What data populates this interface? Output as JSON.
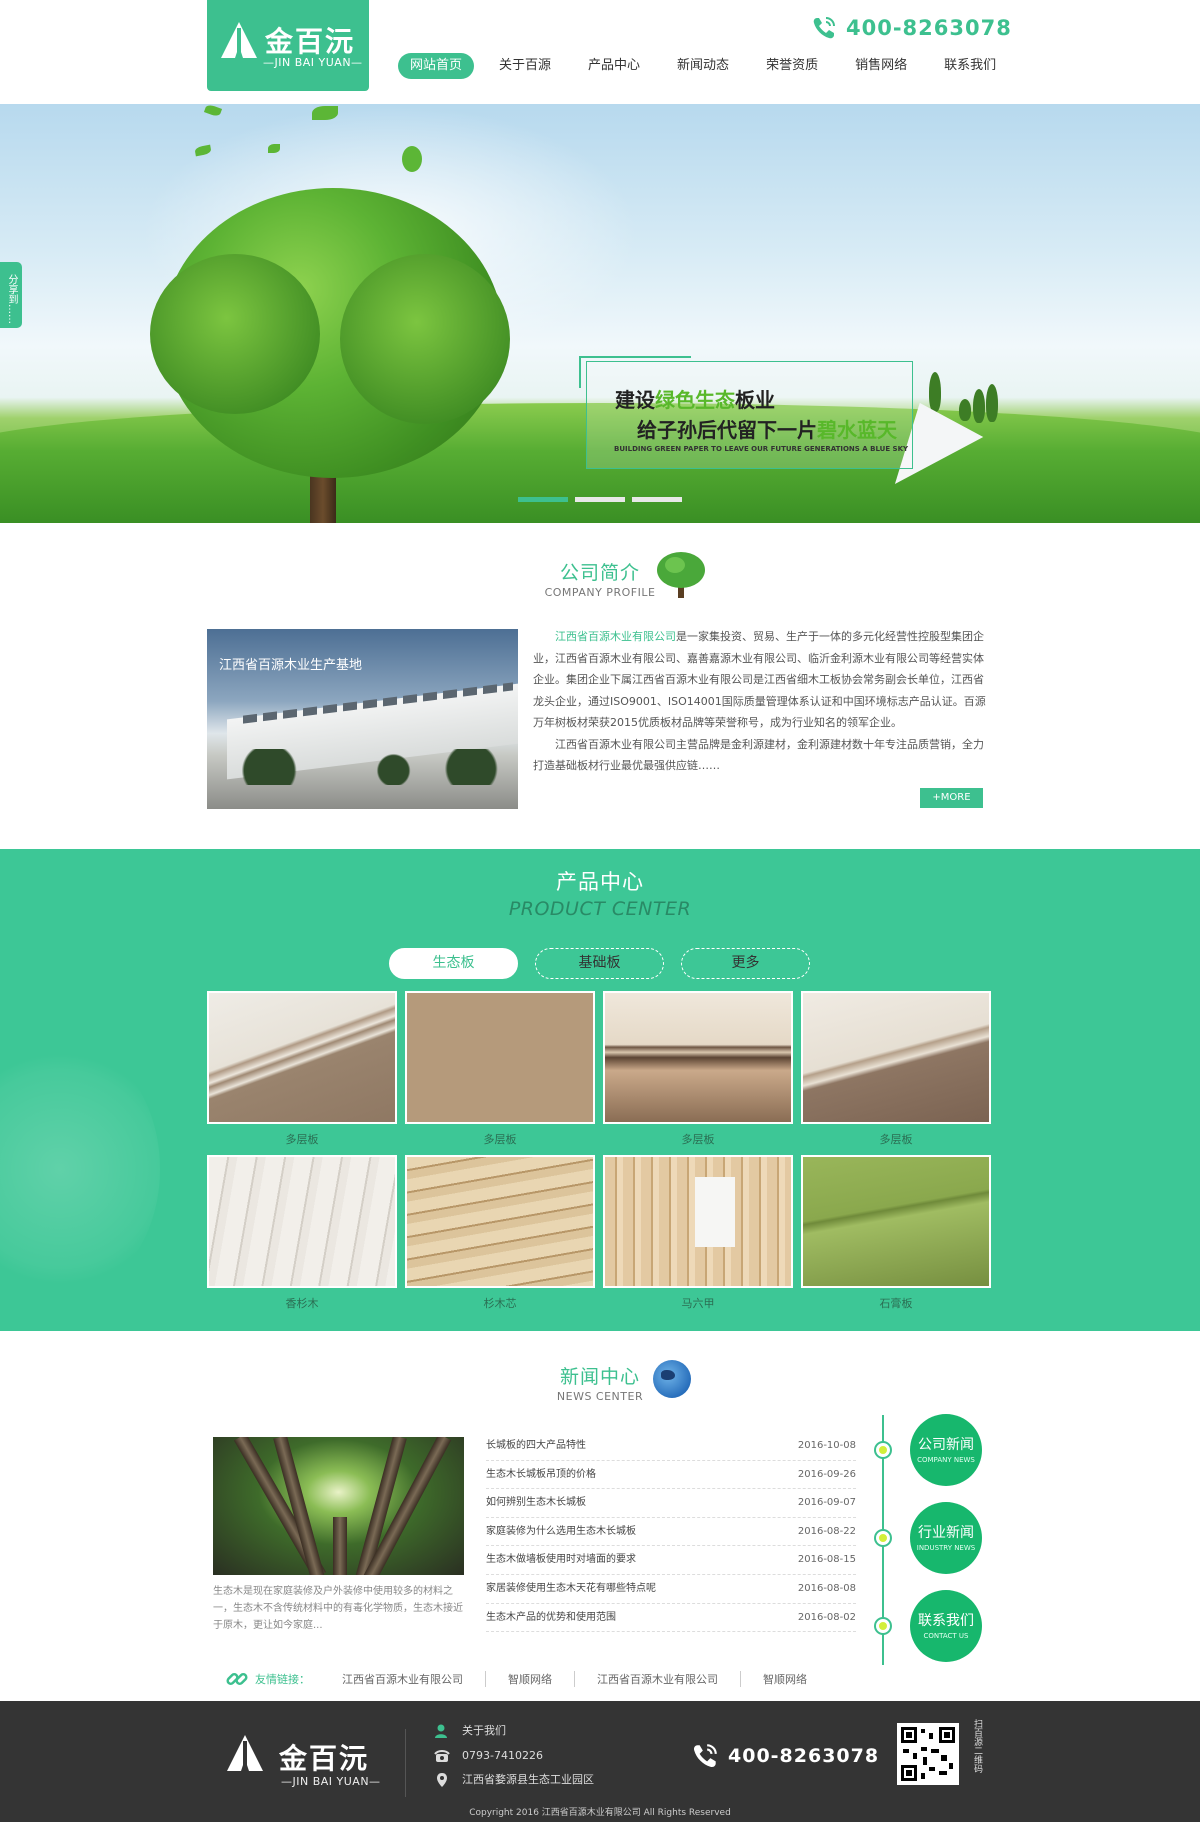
{
  "header": {
    "logo_cn": "金百沅",
    "logo_en": "—JIN BAI YUAN—",
    "hotline": "400-8263078",
    "nav": [
      {
        "label": "网站首页",
        "active": true
      },
      {
        "label": "关于百源",
        "active": false
      },
      {
        "label": "产品中心",
        "active": false
      },
      {
        "label": "新闻动态",
        "active": false
      },
      {
        "label": "荣誉资质",
        "active": false
      },
      {
        "label": "销售网络",
        "active": false
      },
      {
        "label": "联系我们",
        "active": false
      }
    ]
  },
  "share_tab": "分享到……",
  "banner": {
    "line1_a": "建设",
    "line1_hl": "绿色生态",
    "line1_b": "板业",
    "line2_a": "给子孙后代留下一片",
    "line2_hl": "碧水蓝天",
    "line_en": "BUILDING GREEN PAPER TO LEAVE OUR FUTURE GENERATIONS A BLUE SKY",
    "slides": 3,
    "active_slide": 0
  },
  "company": {
    "title_cn": "公司简介",
    "title_en": "COMPANY PROFILE",
    "photo_caption": "江西省百源木业生产基地",
    "company_name": "江西省百源木业有限公司",
    "para1": "是一家集投资、贸易、生产于一体的多元化经营性控股型集团企业，江西省百源木业有限公司、嘉善嘉源木业有限公司、临沂金利源木业有限公司等经营实体企业。集团企业下属江西省百源木业有限公司是江西省细木工板协会常务副会长单位，江西省龙头企业，通过ISO9001、ISO14001国际质量管理体系认证和中国环境标志产品认证。百源万年树板材荣获2015优质板材品牌等荣誉称号，成为行业知名的领军企业。",
    "para2": "江西省百源木业有限公司主营品牌是金利源建材，金利源建材数十年专注品质营销，全力打造基础板材行业最优最强供应链……",
    "more": "+MORE"
  },
  "products": {
    "title_cn": "产品中心",
    "title_en": "PRODUCT CENTER",
    "tabs": [
      "生态板",
      "基础板",
      "更多"
    ],
    "active_tab": 0,
    "items": [
      {
        "label": "多层板"
      },
      {
        "label": "多层板"
      },
      {
        "label": "多层板"
      },
      {
        "label": "多层板"
      },
      {
        "label": "香杉木"
      },
      {
        "label": "杉木芯"
      },
      {
        "label": "马六甲"
      },
      {
        "label": "石膏板"
      }
    ]
  },
  "news": {
    "title_cn": "新闻中心",
    "title_en": "NEWS CENTER",
    "summary": "生态木是现在家庭装修及户外装修中使用较多的材料之一，生态木不含传统材料中的有毒化学物质，生态木接近于原木，更让如今家庭...",
    "list": [
      {
        "title": "长城板的四大产品特性",
        "date": "2016-10-08"
      },
      {
        "title": "生态木长城板吊顶的价格",
        "date": "2016-09-26"
      },
      {
        "title": "如何辨别生态木长城板",
        "date": "2016-09-07"
      },
      {
        "title": "家庭装修为什么选用生态木长城板",
        "date": "2016-08-22"
      },
      {
        "title": "生态木做墙板使用时对墙面的要求",
        "date": "2016-08-15"
      },
      {
        "title": "家居装修使用生态木天花有哪些特点呢",
        "date": "2016-08-08"
      },
      {
        "title": "生态木产品的优势和使用范围",
        "date": "2016-08-02"
      }
    ],
    "categories": [
      {
        "cn": "公司新闻",
        "en": "COMPANY NEWS"
      },
      {
        "cn": "行业新闻",
        "en": "INDUSTRY NEWS"
      },
      {
        "cn": "联系我们",
        "en": "CONTACT US"
      }
    ]
  },
  "links": {
    "label": "友情链接：",
    "items": [
      "江西省百源木业有限公司",
      "智顺网络",
      "江西省百源木业有限公司",
      "智顺网络"
    ]
  },
  "footer": {
    "logo_cn": "金百沅",
    "logo_en": "—JIN BAI YUAN—",
    "about": "关于我们",
    "tel": "0793-7410226",
    "address": "江西省婺源县生态工业园区",
    "hotline": "400-8263078",
    "qr_label": "扫百源二维码",
    "copyright": "Copyright 2016 江西省百源木业有限公司 All Rights Reserved"
  },
  "colors": {
    "brand_green": "#3dc08f",
    "product_bg": "#3dc796",
    "footer_bg": "#343434"
  }
}
